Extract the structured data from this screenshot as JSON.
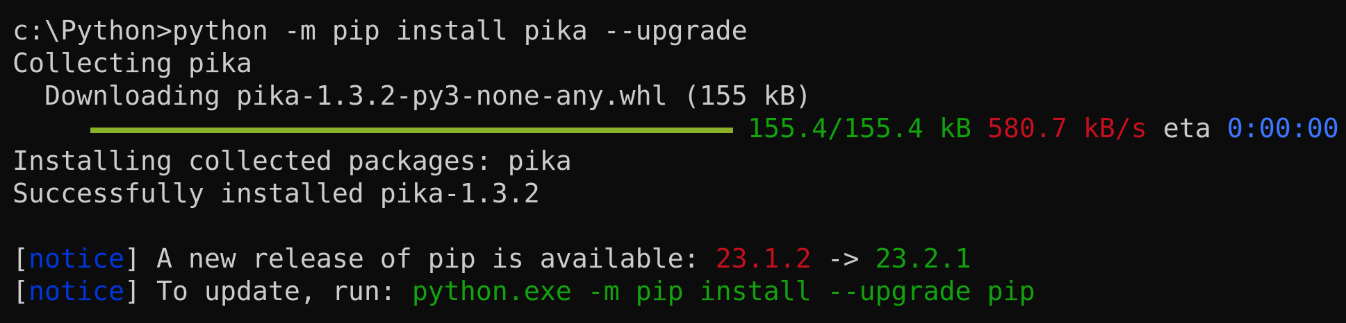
{
  "terminal": {
    "prompt": "c:\\Python>",
    "command": "python -m pip install pika --upgrade",
    "collecting": "Collecting pika",
    "downloading": "Downloading pika-1.3.2-py3-none-any.whl (155 kB)",
    "progress": {
      "fraction": 1.0,
      "size": "155.4/155.4 kB",
      "speed": "580.7 kB/s",
      "eta_label": "eta",
      "eta_value": "0:00:00"
    },
    "installing": "Installing collected packages: pika",
    "success": "Successfully installed pika-1.3.2",
    "notice1": {
      "open": "[",
      "tag": "notice",
      "close": "]",
      "text": " A new release of pip is available: ",
      "old_version": "23.1.2",
      "arrow": " -> ",
      "new_version": "23.2.1"
    },
    "notice2": {
      "open": "[",
      "tag": "notice",
      "close": "]",
      "text": " To update, run: ",
      "command": "python.exe -m pip install --upgrade pip"
    }
  },
  "colors": {
    "background": "#0c0c0c",
    "text": "#cccccc",
    "green": "#13a10e",
    "red": "#c50f1f",
    "blue": "#3b78ff",
    "navy": "#0037da",
    "progress_bar": "#8ab02a"
  }
}
